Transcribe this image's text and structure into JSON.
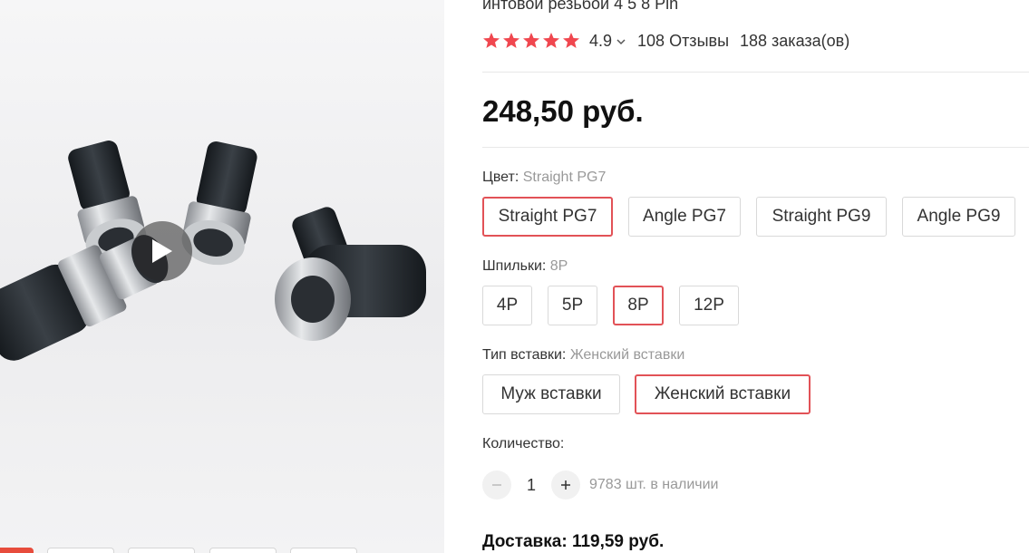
{
  "product": {
    "title_fragment": "интовой резьбой 4 5 8 Pin",
    "rating": "4.9",
    "reviews": "108 Отзывы",
    "orders": "188 заказа(ов)",
    "price": "248,50 руб.",
    "star_color": "#f0474f",
    "accent_color": "#e25257"
  },
  "media": {
    "has_video": true
  },
  "color_prop": {
    "label": "Цвет:",
    "selected": "Straight PG7",
    "options": [
      "Straight PG7",
      "Angle PG7",
      "Straight PG9",
      "Angle PG9"
    ]
  },
  "pins_prop": {
    "label": "Шпильки:",
    "selected": "8P",
    "options": [
      "4P",
      "5P",
      "8P",
      "12P"
    ]
  },
  "insert_prop": {
    "label": "Тип вставки:",
    "selected": "Женский вставки",
    "options": [
      "Муж вставки",
      "Женский вставки"
    ]
  },
  "quantity": {
    "label": "Количество:",
    "value": "1",
    "stock": "9783 шт. в наличии"
  },
  "delivery": {
    "label": "Доставка:",
    "value": "119,59 руб."
  }
}
